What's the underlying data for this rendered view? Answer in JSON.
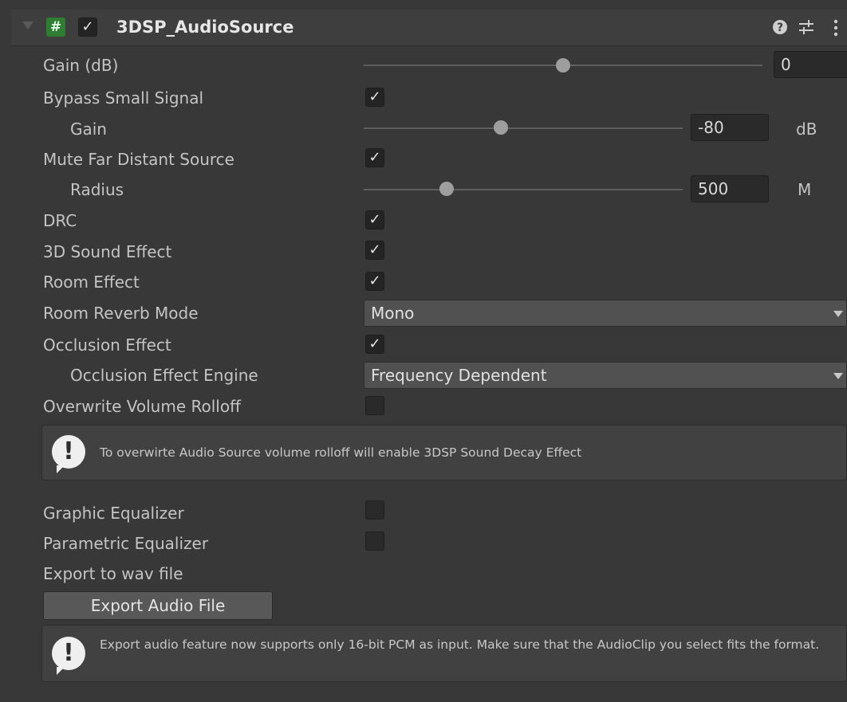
{
  "component": {
    "title": "3DSP_AudioSource",
    "enabled": true,
    "icons": [
      "help-icon",
      "preset-icon",
      "kebab-menu-icon"
    ],
    "script_icon_glyph": "#"
  },
  "fields": {
    "gain_db": {
      "label": "Gain (dB)",
      "value": "0",
      "level": 0.5
    },
    "bypass_small_signal": {
      "label": "Bypass Small Signal",
      "checked": true
    },
    "bypass_gain": {
      "label": "Gain",
      "value": "-80",
      "unit": "dB",
      "level": 0.43
    },
    "mute_far_distant_source": {
      "label": "Mute Far Distant Source",
      "checked": true
    },
    "radius": {
      "label": "Radius",
      "value": "500",
      "unit": "M",
      "level": 0.26
    },
    "drc": {
      "label": "DRC",
      "checked": true
    },
    "sound_effect_3d": {
      "label": "3D Sound Effect",
      "checked": true
    },
    "room_effect": {
      "label": "Room Effect",
      "checked": true
    },
    "room_reverb_mode": {
      "label": "Room Reverb Mode",
      "selected": "Mono"
    },
    "occlusion_effect": {
      "label": "Occlusion Effect",
      "checked": true
    },
    "occlusion_effect_engine": {
      "label": "Occlusion Effect Engine",
      "selected": "Frequency Dependent"
    },
    "overwrite_volume_rolloff": {
      "label": "Overwrite Volume Rolloff",
      "checked": false
    },
    "rolloff_help": {
      "text": "To overwirte Audio Source volume rolloff will enable 3DSP Sound Decay Effect"
    },
    "graphic_equalizer": {
      "label": "Graphic Equalizer",
      "checked": false
    },
    "parametric_equalizer": {
      "label": "Parametric Equalizer",
      "checked": false
    },
    "export_label": {
      "label": "Export to wav file"
    },
    "export_button": {
      "label": "Export Audio File"
    },
    "export_help": {
      "text": "Export audio feature now supports only 16-bit PCM as input. Make sure that the AudioClip you select fits the format."
    }
  },
  "check_glyph": "✓",
  "colors": {
    "background": "#383838",
    "script_icon": "#2e7d32",
    "help_icon": "#efefef"
  }
}
